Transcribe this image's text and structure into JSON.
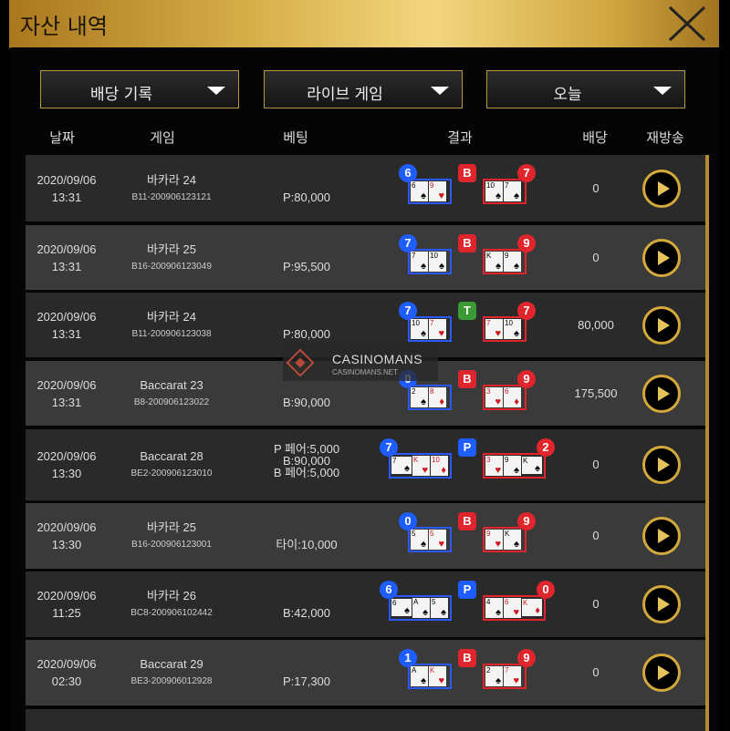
{
  "window": {
    "title": "자산 내역"
  },
  "filters": [
    {
      "label": "배당 기록"
    },
    {
      "label": "라이브 게임"
    },
    {
      "label": "오늘"
    }
  ],
  "headers": {
    "date": "날짜",
    "game": "게임",
    "bet": "베팅",
    "result": "결과",
    "payout": "배당",
    "replay": "재방송"
  },
  "watermark": {
    "brand": "CASINOMANS",
    "site": "CASINOMANS.NET"
  },
  "rows": [
    {
      "date": "2020/09/06",
      "time": "13:31",
      "game": "바카라 24",
      "round": "B11-200906123121",
      "bet": [
        "P:80,000"
      ],
      "player_score": "6",
      "banker_score": "7",
      "winner": "B",
      "payout": "0",
      "player_cards": [
        [
          "6",
          "♠"
        ],
        [
          "9",
          "♥"
        ]
      ],
      "banker_cards": [
        [
          "10",
          "♠"
        ],
        [
          "7",
          "♠"
        ]
      ]
    },
    {
      "date": "2020/09/06",
      "time": "13:31",
      "game": "바카라 25",
      "round": "B16-200906123049",
      "bet": [
        "P:95,500"
      ],
      "player_score": "7",
      "banker_score": "9",
      "winner": "B",
      "payout": "0",
      "player_cards": [
        [
          "7",
          "♠"
        ],
        [
          "10",
          "♠"
        ]
      ],
      "banker_cards": [
        [
          "K",
          "♠"
        ],
        [
          "9",
          "♠"
        ]
      ]
    },
    {
      "date": "2020/09/06",
      "time": "13:31",
      "game": "바카라 24",
      "round": "B11-200906123038",
      "bet": [
        "P:80,000"
      ],
      "player_score": "7",
      "banker_score": "7",
      "winner": "T",
      "payout": "80,000",
      "player_cards": [
        [
          "10",
          "♠"
        ],
        [
          "7",
          "♥"
        ]
      ],
      "banker_cards": [
        [
          "7",
          "♥"
        ],
        [
          "10",
          "♠"
        ]
      ]
    },
    {
      "date": "2020/09/06",
      "time": "13:31",
      "game": "Baccarat 23",
      "round": "B8-200906123022",
      "bet": [
        "B:90,000"
      ],
      "player_score": "0",
      "banker_score": "9",
      "winner": "B",
      "payout": "175,500",
      "player_cards": [
        [
          "2",
          "♠"
        ],
        [
          "8",
          "♦"
        ]
      ],
      "banker_cards": [
        [
          "3",
          "♥"
        ],
        [
          "6",
          "♦"
        ]
      ]
    },
    {
      "date": "2020/09/06",
      "time": "13:30",
      "game": "Baccarat 28",
      "round": "BE2-200906123010",
      "bet": [
        "P 페어:5,000",
        "B:90,000",
        "B 페어:5,000"
      ],
      "player_score": "7",
      "banker_score": "2",
      "winner": "P",
      "payout": "0",
      "player_cards": [
        [
          "7",
          "♠"
        ],
        [
          "K",
          "♥"
        ],
        [
          "10",
          "♦"
        ]
      ],
      "banker_cards": [
        [
          "3",
          "♥"
        ],
        [
          "9",
          "♠"
        ],
        [
          "K",
          "♠"
        ]
      ]
    },
    {
      "date": "2020/09/06",
      "time": "13:30",
      "game": "바카라 25",
      "round": "B16-200906123001",
      "bet": [
        "타이:10,000"
      ],
      "player_score": "0",
      "banker_score": "9",
      "winner": "B",
      "payout": "0",
      "player_cards": [
        [
          "5",
          "♠"
        ],
        [
          "5",
          "♥"
        ]
      ],
      "banker_cards": [
        [
          "9",
          "♥"
        ],
        [
          "K",
          "♠"
        ]
      ]
    },
    {
      "date": "2020/09/06",
      "time": "11:25",
      "game": "바카라 26",
      "round": "BC8-200906102442",
      "bet": [
        "B:42,000"
      ],
      "player_score": "6",
      "banker_score": "0",
      "winner": "P",
      "payout": "0",
      "player_cards": [
        [
          "6",
          "♠"
        ],
        [
          "A",
          "♠"
        ],
        [
          "5",
          "♠"
        ]
      ],
      "banker_cards": [
        [
          "4",
          "♠"
        ],
        [
          "6",
          "♥"
        ],
        [
          "K",
          "♦"
        ]
      ]
    },
    {
      "date": "2020/09/06",
      "time": "02:30",
      "game": "Baccarat 29",
      "round": "BE3-200906012928",
      "bet": [
        "P:17,300"
      ],
      "player_score": "1",
      "banker_score": "9",
      "winner": "B",
      "payout": "0",
      "player_cards": [
        [
          "A",
          "♠"
        ],
        [
          "K",
          "♥"
        ]
      ],
      "banker_cards": [
        [
          "2",
          "♠"
        ],
        [
          "7",
          "♥"
        ]
      ]
    }
  ]
}
